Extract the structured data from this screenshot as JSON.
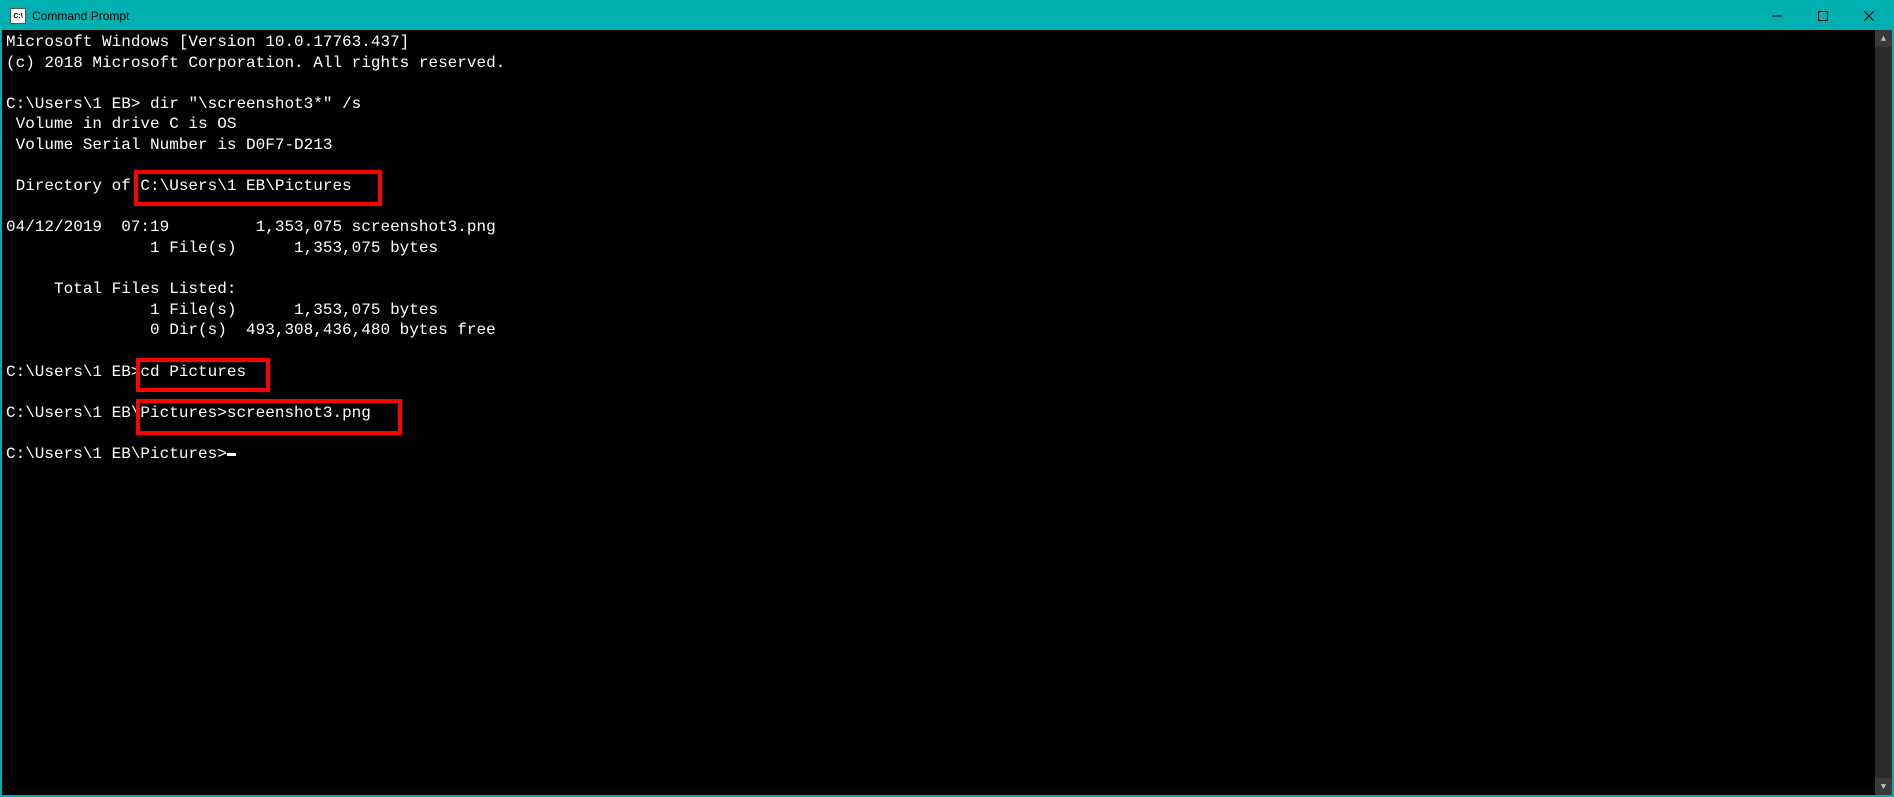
{
  "titlebar": {
    "icon_label": "C:\\",
    "title": "Command Prompt"
  },
  "terminal": {
    "header1": "Microsoft Windows [Version 10.0.17763.437]",
    "header2": "(c) 2018 Microsoft Corporation. All rights reserved.",
    "blank": "",
    "prompt1_prefix": "C:\\Users\\1 EB> ",
    "prompt1_cmd": "dir \"\\screenshot3*\" /s",
    "vol1": " Volume in drive C is OS",
    "vol2": " Volume Serial Number is D0F7-D213",
    "dir_of_prefix": " Directory of ",
    "dir_of_path": "C:\\Users\\1 EB\\Pictures",
    "listing1": "04/12/2019  07:19         1,353,075 screenshot3.png",
    "listing2": "               1 File(s)      1,353,075 bytes",
    "total_label": "     Total Files Listed:",
    "total1": "               1 File(s)      1,353,075 bytes",
    "total2": "               0 Dir(s)  493,308,436,480 bytes free",
    "prompt2_prefix": "C:\\Users\\1 EB>",
    "prompt2_cmd": "cd Pictures",
    "prompt3_prefix": "C:\\Users\\1 EB\\",
    "prompt3_mid": "Pictures>",
    "prompt3_cmd": "screenshot3.png",
    "prompt4": "C:\\Users\\1 EB\\Pictures>"
  }
}
